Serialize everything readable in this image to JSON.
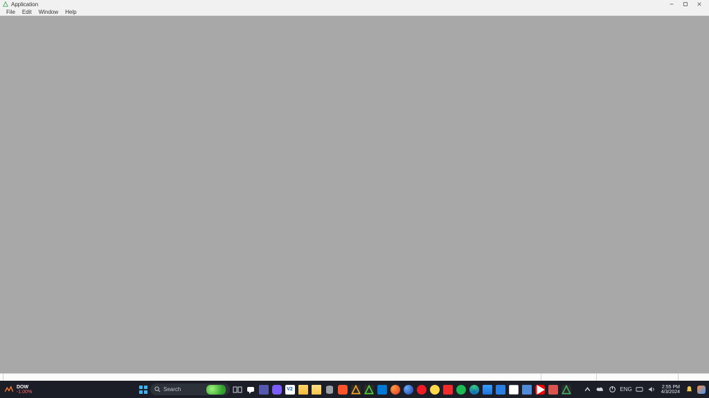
{
  "window": {
    "title": "Application",
    "menu": [
      "File",
      "Edit",
      "Window",
      "Help"
    ]
  },
  "taskbar": {
    "widget": {
      "symbol": "DOW",
      "change": "-1.00%"
    },
    "search_placeholder": "Search",
    "language": "ENG",
    "time": "2:55 PM",
    "date": "4/3/2024",
    "center_icons": [
      "start",
      "search",
      "task-view",
      "chat",
      "teams",
      "viber",
      "vnc",
      "file-explorer",
      "folder-docs",
      "db-tool",
      "brave",
      "app-a",
      "app-b",
      "vscode",
      "firefox",
      "firefox-dev",
      "opera",
      "emoji-app",
      "anydesk",
      "spotify",
      "edge",
      "photos",
      "store",
      "calendar",
      "notes",
      "youtube",
      "recorder",
      "app-c"
    ],
    "tray_icons": [
      "chevron-up",
      "onedrive",
      "power",
      "devices",
      "volume"
    ]
  }
}
